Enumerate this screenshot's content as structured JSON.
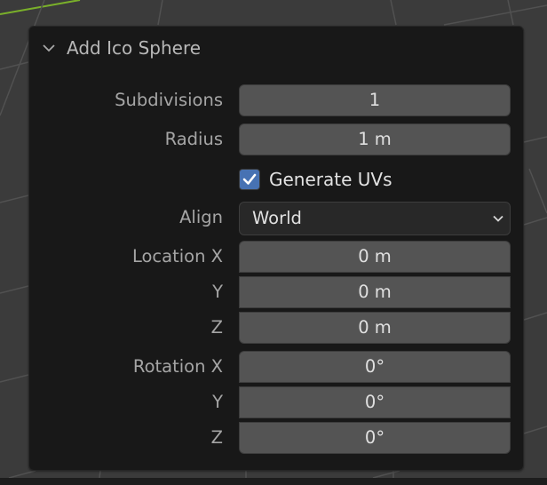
{
  "panel": {
    "title": "Add Ico Sphere",
    "collapse_icon": "chevron-down-icon"
  },
  "fields": {
    "subdivisions": {
      "label": "Subdivisions",
      "value": "1"
    },
    "radius": {
      "label": "Radius",
      "value": "1 m"
    },
    "generate_uvs": {
      "label": "Generate UVs",
      "checked": true
    },
    "align": {
      "label": "Align",
      "value": "World",
      "icon": "chevron-down-icon"
    },
    "location": {
      "label_x": "Location X",
      "label_y": "Y",
      "label_z": "Z",
      "x": "0 m",
      "y": "0 m",
      "z": "0 m"
    },
    "rotation": {
      "label_x": "Rotation X",
      "label_y": "Y",
      "label_z": "Z",
      "x": "0°",
      "y": "0°",
      "z": "0°"
    }
  },
  "colors": {
    "checkbox_accent": "#4772b3",
    "grid_axis_green": "#6fa32c"
  }
}
